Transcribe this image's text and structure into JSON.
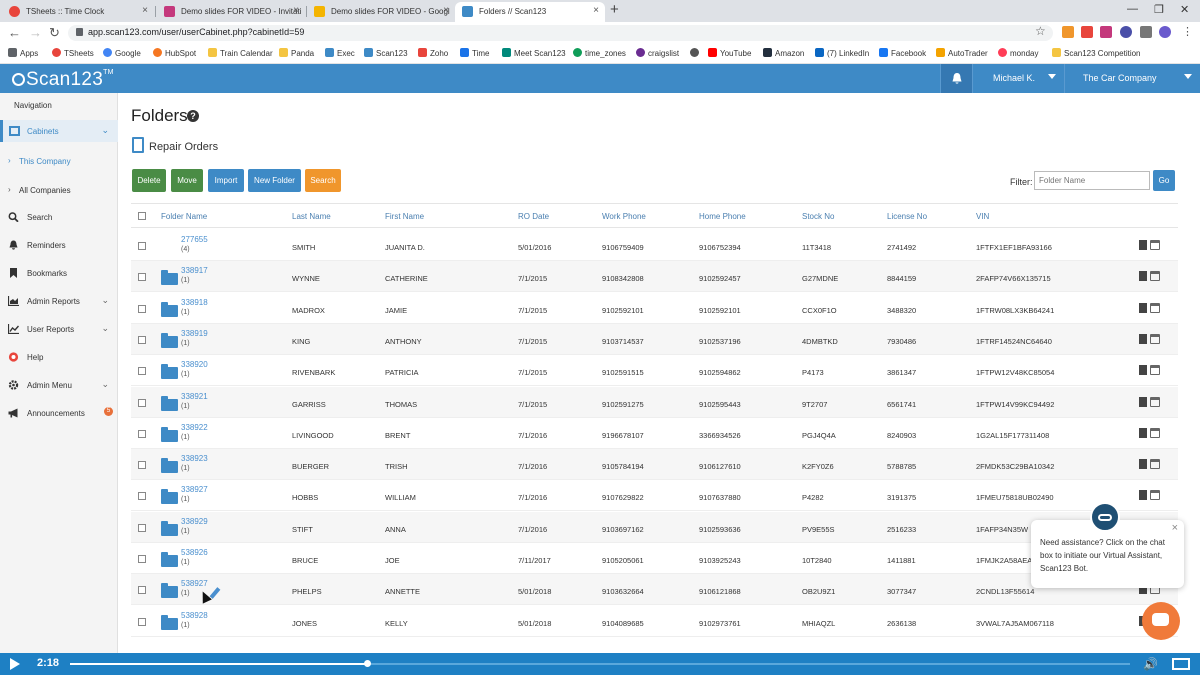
{
  "browser": {
    "tabs": [
      {
        "title": "TSheets :: Time Clock",
        "icon_color": "#e8453c"
      },
      {
        "title": "Demo slides FOR VIDEO - Invitati",
        "icon_color": "#c4387c"
      },
      {
        "title": "Demo slides FOR VIDEO - Googl",
        "icon_color": "#f4b400"
      },
      {
        "title": "Folders // Scan123",
        "icon_color": "#3e8ac6"
      }
    ],
    "url": "app.scan123.com/user/userCabinet.php?cabinetId=59",
    "bookmarks": [
      "Apps",
      "TSheets",
      "Google",
      "HubSpot",
      "Train Calendar",
      "Panda",
      "Exec",
      "Scan123",
      "Zoho",
      "Time",
      "Meet Scan123",
      "time_zones",
      "craigslist",
      "",
      "YouTube",
      "Amazon",
      "(7) LinkedIn",
      "Facebook",
      "AutoTrader",
      "monday",
      "Scan123 Competition"
    ]
  },
  "app": {
    "logo": "Scan123",
    "trademark": "TM",
    "user_name": "Michael K.",
    "company_name": "The Car Company"
  },
  "sidebar": {
    "title": "Navigation",
    "items": [
      {
        "label": "Cabinets",
        "icon": "cabinet-icon",
        "selected": true
      },
      {
        "label": "This Company",
        "sub": true
      },
      {
        "label": "All Companies",
        "sub": true
      },
      {
        "label": "Search",
        "icon": "search-icon"
      },
      {
        "label": "Reminders",
        "icon": "bell-icon"
      },
      {
        "label": "Bookmarks",
        "icon": "bookmark-icon"
      },
      {
        "label": "Admin Reports",
        "icon": "chart-icon"
      },
      {
        "label": "User Reports",
        "icon": "line-chart-icon"
      },
      {
        "label": "Help",
        "icon": "help-icon"
      },
      {
        "label": "Admin Menu",
        "icon": "gear-icon"
      },
      {
        "label": "Announcements",
        "icon": "megaphone-icon",
        "badge": "5"
      }
    ]
  },
  "main": {
    "title": "Folders",
    "subtitle": "Repair Orders",
    "buttons": {
      "delete": "Delete",
      "move": "Move",
      "import": "Import",
      "new_folder": "New Folder",
      "search": "Search"
    },
    "filter": {
      "label": "Filter:",
      "placeholder": "Folder Name",
      "go": "Go"
    },
    "columns": [
      "Folder Name",
      "Last Name",
      "First Name",
      "RO Date",
      "Work Phone",
      "Home Phone",
      "Stock No",
      "License No",
      "VIN"
    ],
    "rows": [
      {
        "folder": "277655",
        "count": "(4)",
        "last": "SMITH",
        "first": "JUANITA D.",
        "ro_date": "5/01/2016",
        "work": "9106759409",
        "home": "9106752394",
        "stock": "11T3418",
        "license": "2741492",
        "vin": "1FTFX1EF1BFA93166"
      },
      {
        "folder": "338917",
        "count": "(1)",
        "last": "WYNNE",
        "first": "CATHERINE",
        "ro_date": "7/1/2015",
        "work": "9108342808",
        "home": "9102592457",
        "stock": "G27MDNE",
        "license": "8844159",
        "vin": "2FAFP74V66X135715"
      },
      {
        "folder": "338918",
        "count": "(1)",
        "last": "MADROX",
        "first": "JAMIE",
        "ro_date": "7/1/2015",
        "work": "9102592101",
        "home": "9102592101",
        "stock": "CCX0F1O",
        "license": "3488320",
        "vin": "1FTRW08LX3KB64241"
      },
      {
        "folder": "338919",
        "count": "(1)",
        "last": "KING",
        "first": "ANTHONY",
        "ro_date": "7/1/2015",
        "work": "9103714537",
        "home": "9102537196",
        "stock": "4DMBTKD",
        "license": "7930486",
        "vin": "1FTRF14524NC64640"
      },
      {
        "folder": "338920",
        "count": "(1)",
        "last": "RIVENBARK",
        "first": "PATRICIA",
        "ro_date": "7/1/2015",
        "work": "9102591515",
        "home": "9102594862",
        "stock": "P4173",
        "license": "3861347",
        "vin": "1FTPW12V48KC85054"
      },
      {
        "folder": "338921",
        "count": "(1)",
        "last": "GARRISS",
        "first": "THOMAS",
        "ro_date": "7/1/2015",
        "work": "9102591275",
        "home": "9102595443",
        "stock": "9T2707",
        "license": "6561741",
        "vin": "1FTPW14V99KC94492"
      },
      {
        "folder": "338922",
        "count": "(1)",
        "last": "LIVINGOOD",
        "first": "BRENT",
        "ro_date": "7/1/2016",
        "work": "9196678107",
        "home": "3366934526",
        "stock": "PGJ4Q4A",
        "license": "8240903",
        "vin": "1G2AL15F177311408"
      },
      {
        "folder": "338923",
        "count": "(1)",
        "last": "BUERGER",
        "first": "TRISH",
        "ro_date": "7/1/2016",
        "work": "9105784194",
        "home": "9106127610",
        "stock": "K2FY0Z6",
        "license": "5788785",
        "vin": "2FMDK53C29BA10342"
      },
      {
        "folder": "338927",
        "count": "(1)",
        "last": "HOBBS",
        "first": "WILLIAM",
        "ro_date": "7/1/2016",
        "work": "9107629822",
        "home": "9107637880",
        "stock": "P4282",
        "license": "3191375",
        "vin": "1FMEU75818UB02490"
      },
      {
        "folder": "338929",
        "count": "(1)",
        "last": "STIFT",
        "first": "ANNA",
        "ro_date": "7/1/2016",
        "work": "9103697162",
        "home": "9102593636",
        "stock": "PV9E55S",
        "license": "2516233",
        "vin": "1FAFP34N35W"
      },
      {
        "folder": "538926",
        "count": "(1)",
        "last": "BRUCE",
        "first": "JOE",
        "ro_date": "7/11/2017",
        "work": "9105205061",
        "home": "9103925243",
        "stock": "10T2840",
        "license": "1411881",
        "vin": "1FMJK2A58AEA"
      },
      {
        "folder": "538927",
        "count": "(1)",
        "last": "PHELPS",
        "first": "ANNETTE",
        "ro_date": "5/01/2018",
        "work": "9103632664",
        "home": "9106121868",
        "stock": "OB2U9Z1",
        "license": "3077347",
        "vin": "2CNDL13F55614"
      },
      {
        "folder": "538928",
        "count": "(1)",
        "last": "JONES",
        "first": "KELLY",
        "ro_date": "5/01/2018",
        "work": "9104089685",
        "home": "9102973761",
        "stock": "MHIAQZL",
        "license": "2636138",
        "vin": "3VWAL7AJ5AM067118"
      }
    ]
  },
  "chat": {
    "message": "Need assistance? Click on the chat box to initiate our Virtual Assistant, Scan123 Bot."
  },
  "video": {
    "time": "2:18",
    "progress": 0.28
  },
  "colors": {
    "brand": "#3e8ac6",
    "delete": "#4a8c45",
    "move": "#4a8c45",
    "import": "#3e8ac6",
    "new_folder": "#3e8ac6",
    "search": "#f0962c",
    "chat": "#f07a3a"
  }
}
